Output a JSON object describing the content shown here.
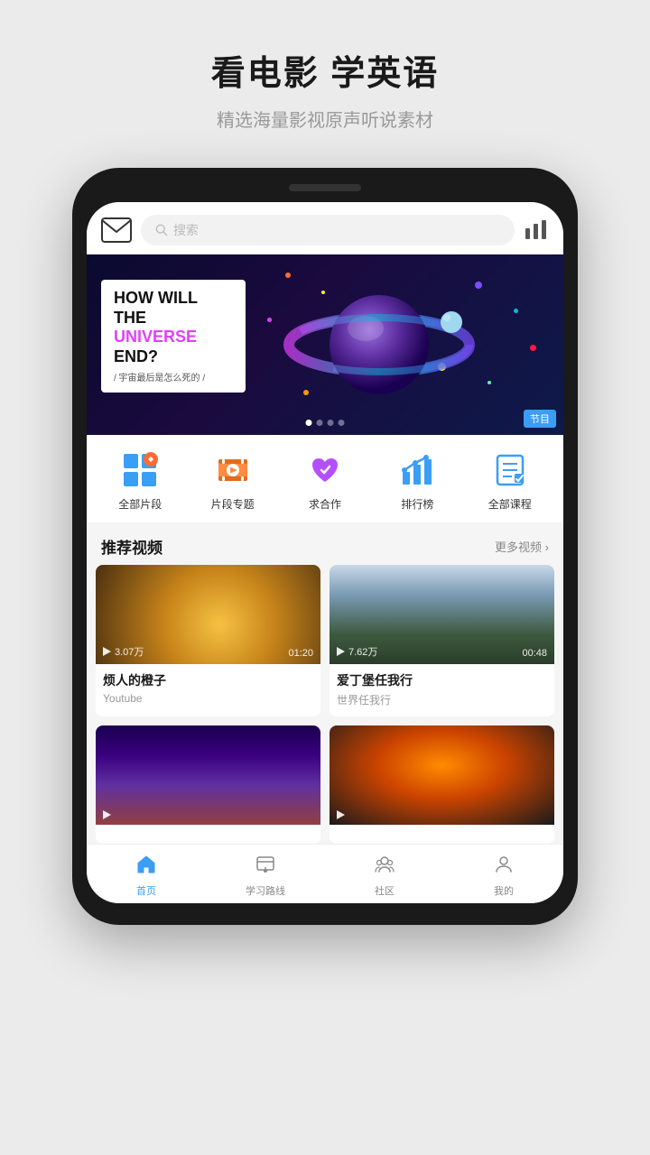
{
  "header": {
    "title": "看电影 学英语",
    "subtitle": "精选海量影视原声听说素材"
  },
  "app": {
    "search_placeholder": "搜索",
    "banner": {
      "title_line1": "HOW WILL",
      "title_line2": "THE ",
      "title_highlight": "UNIVERSE",
      "title_line3": " END?",
      "subtitle": "/ 宇宙最后是怎么死的 /",
      "tag": "节目",
      "dots": [
        true,
        false,
        false,
        false
      ]
    },
    "categories": [
      {
        "label": "全部片段",
        "icon": "segments"
      },
      {
        "label": "片段专题",
        "icon": "film"
      },
      {
        "label": "求合作",
        "icon": "heart"
      },
      {
        "label": "排行榜",
        "icon": "chart"
      },
      {
        "label": "全部课程",
        "icon": "courses"
      }
    ],
    "recommended": {
      "title": "推荐视频",
      "more_label": "更多视频 ›"
    },
    "videos": [
      {
        "title": "烦人的橙子",
        "source": "Youtube",
        "views": "3.07万",
        "duration": "01:20",
        "thumb_class": "thumb-orange"
      },
      {
        "title": "爱丁堡任我行",
        "source": "世界任我行",
        "views": "7.62万",
        "duration": "00:48",
        "thumb_class": "thumb-castle"
      },
      {
        "title": "",
        "source": "",
        "views": "",
        "duration": "",
        "thumb_class": "thumb-city"
      },
      {
        "title": "",
        "source": "",
        "views": "",
        "duration": "",
        "thumb_class": "thumb-carousel"
      }
    ],
    "nav": [
      {
        "label": "首页",
        "active": true
      },
      {
        "label": "学习路线",
        "active": false
      },
      {
        "label": "社区",
        "active": false
      },
      {
        "label": "我的",
        "active": false
      }
    ]
  }
}
